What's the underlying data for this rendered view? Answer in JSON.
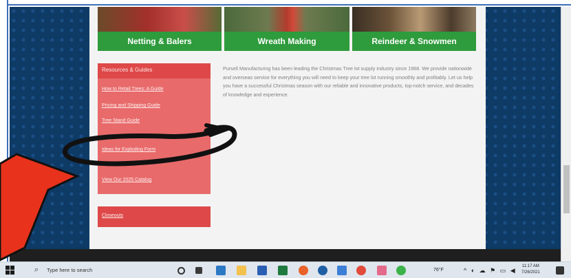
{
  "tiles": [
    {
      "label": "Netting & Balers"
    },
    {
      "label": "Wreath Making"
    },
    {
      "label": "Reindeer & Snowmen"
    }
  ],
  "sidebar": {
    "title": "Resources & Guides",
    "links": [
      "How to Retail Trees: A Guide",
      "Pricing and Shipping Guide",
      "Tree Stand Guide",
      "Ideas for Exploding Form",
      "View Our 2025 Catalog"
    ]
  },
  "resources_box": {
    "link": "Closeouts"
  },
  "intro_text": "Pursell Manufacturing has been leading the Christmas Tree lot supply industry since 1968. We provide nationwide and overseas service for everything you will need to keep your tree lot running smoothly and profitably. Let us help you have a successful Christmas season with our reliable and innovative products, top-notch service, and decades of knowledge and experience.",
  "taskbar": {
    "search_placeholder": "Type here to search",
    "weather": "76°F",
    "time": "11:17 AM",
    "date": "7/26/2021"
  },
  "colors": {
    "page_background": "#0e3a66",
    "tile_bar_green": "#2e9b3c",
    "sidebar_red": "#e86a6a",
    "sidebar_header_red": "#de4848",
    "annotation_arrow": "#e8321c",
    "annotation_loop": "#111111"
  }
}
